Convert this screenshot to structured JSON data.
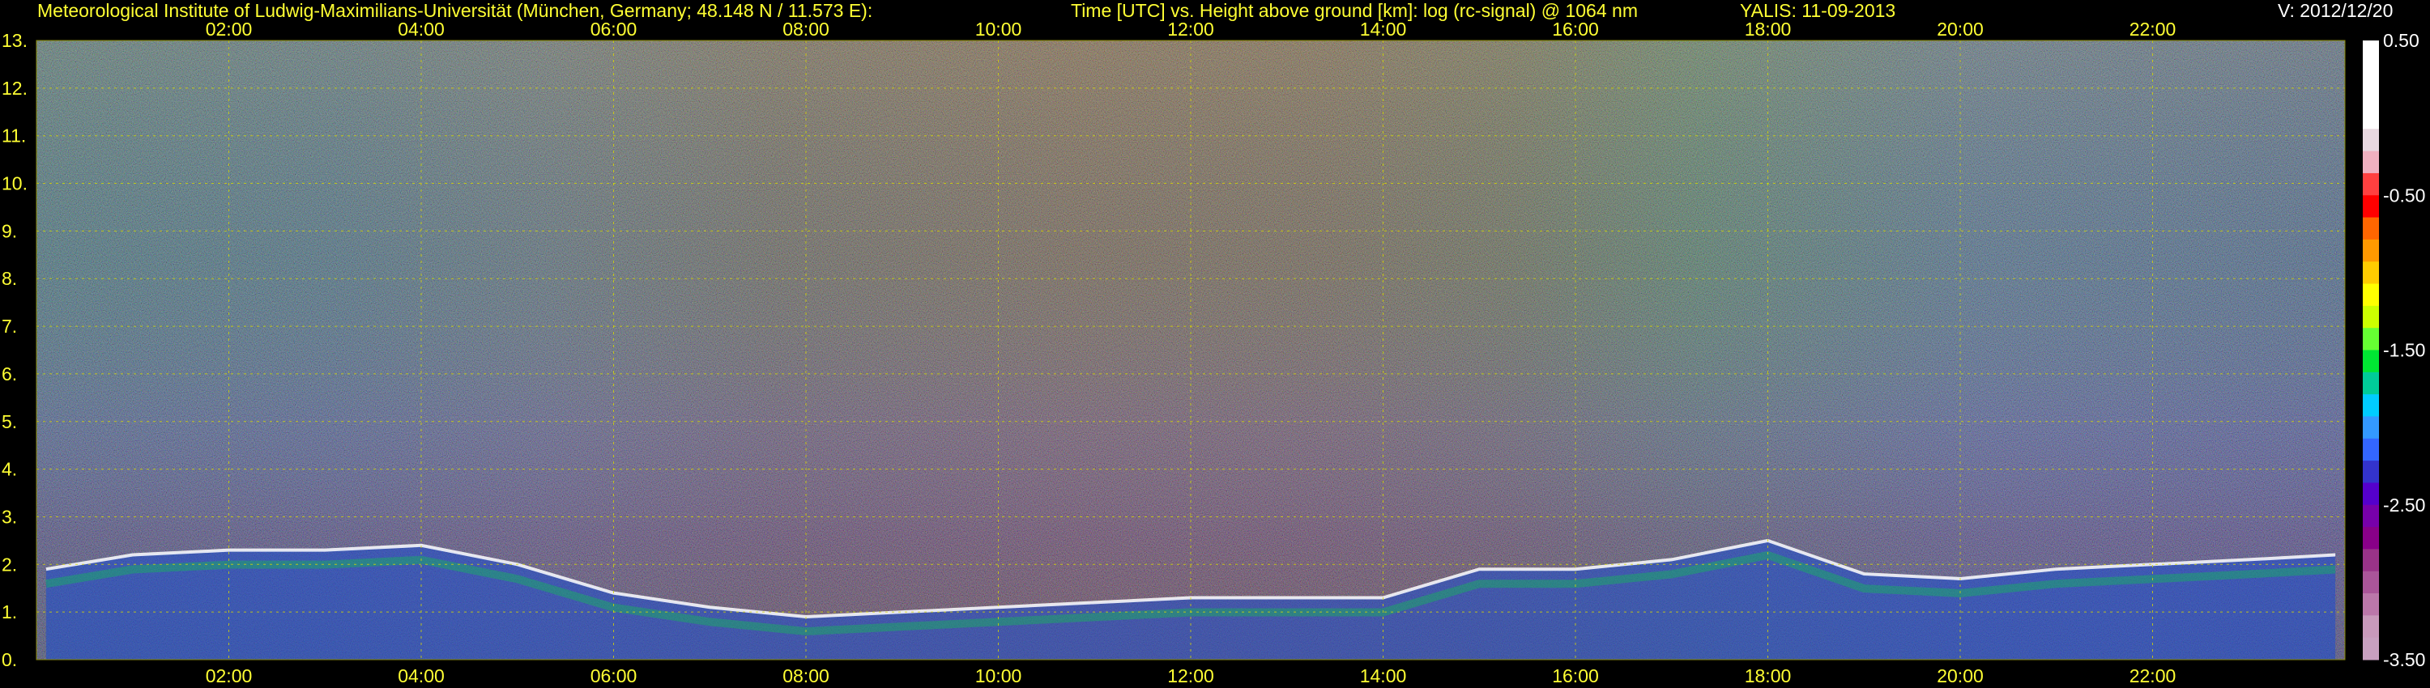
{
  "header": {
    "institute": "Meteorological Institute of Ludwig-Maximilians-Universität (München, Germany; 48.148 N / 11.573 E):",
    "description": "Time [UTC] vs. Height above ground [km]: log (rc-signal) @ 1064 nm",
    "instrument": "YALIS: 11-09-2013",
    "version": "V: 2012/12/20"
  },
  "colors": {
    "background": "#000000",
    "text": "#ffff33",
    "grid": "#d8d800"
  },
  "chart_data": {
    "type": "heatmap",
    "title": "Time [UTC] vs. Height above ground [km]: log (rc-signal) @ 1064 nm",
    "x_ticks": [
      "02:00",
      "04:00",
      "06:00",
      "08:00",
      "10:00",
      "12:00",
      "14:00",
      "16:00",
      "18:00",
      "20:00",
      "22:00"
    ],
    "x_range_hours": [
      0,
      24
    ],
    "y_ticks": [
      "0.",
      "1.",
      "2.",
      "3.",
      "4.",
      "5.",
      "6.",
      "7.",
      "8.",
      "9.",
      "10.",
      "11.",
      "12.",
      "13."
    ],
    "y_range_km": [
      0,
      13
    ],
    "grid": true,
    "colorbar": {
      "labels": [
        "0.50",
        "-0.50",
        "-1.50",
        "-2.50",
        "-3.50"
      ],
      "range": [
        -3.5,
        0.5
      ],
      "colors": [
        "#ffffff",
        "#ffffff",
        "#ffffff",
        "#ffffff",
        "#e8d8e0",
        "#f0b0c0",
        "#ff4040",
        "#ff0000",
        "#ff6600",
        "#ff9900",
        "#ffcc00",
        "#ffff00",
        "#ccff00",
        "#66ff33",
        "#00e633",
        "#00cc99",
        "#00ccff",
        "#3399ff",
        "#3366ff",
        "#3333cc",
        "#5500cc",
        "#7700aa",
        "#880088",
        "#993388",
        "#aa5599",
        "#bb77aa",
        "#c899bb",
        "#c8a0c0"
      ]
    },
    "features": [
      {
        "kind": "aerosol boundary layer top (km)",
        "time_hours": [
          0.1,
          1.0,
          2.0,
          3.0,
          4.0,
          5.0,
          6.0,
          7.0,
          8.0,
          9.0,
          10.0,
          11.0,
          12.0,
          13.0,
          14.0,
          15.0,
          16.0,
          17.0,
          18.0,
          19.0,
          20.0,
          21.0,
          22.0,
          23.0,
          23.9
        ],
        "height_km": [
          1.9,
          2.2,
          2.3,
          2.3,
          2.4,
          2.0,
          1.4,
          1.1,
          0.9,
          1.0,
          1.1,
          1.2,
          1.3,
          1.3,
          1.3,
          1.9,
          1.9,
          2.1,
          2.5,
          1.8,
          1.7,
          1.9,
          2.0,
          2.1,
          2.2
        ]
      }
    ]
  }
}
